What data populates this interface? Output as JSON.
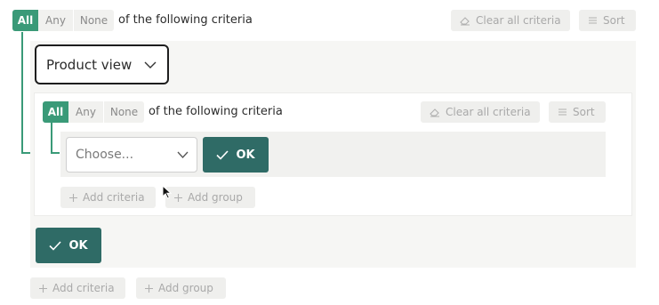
{
  "outer": {
    "match_options": [
      "All",
      "Any",
      "None"
    ],
    "match_selected": "All",
    "criteria_text": "of the following criteria",
    "clear_label": "Clear all criteria",
    "sort_label": "Sort",
    "add_criteria_label": "Add criteria",
    "add_group_label": "Add group"
  },
  "group": {
    "field_select_value": "Product view",
    "ok_label": "OK"
  },
  "inner": {
    "match_options": [
      "All",
      "Any",
      "None"
    ],
    "match_selected": "All",
    "criteria_text": "of the following criteria",
    "clear_label": "Clear all criteria",
    "sort_label": "Sort",
    "choose_placeholder": "Choose...",
    "ok_label": "OK",
    "add_criteria_label": "Add criteria",
    "add_group_label": "Add group"
  },
  "colors": {
    "accent_green": "#3a9a78",
    "ok_button": "#2f6b66",
    "panel_bg": "#f6f6f4"
  },
  "icons": [
    "eraser-icon",
    "sort-lines-icon",
    "plus-icon",
    "check-icon",
    "chevron-down-icon",
    "mouse-cursor-icon"
  ]
}
